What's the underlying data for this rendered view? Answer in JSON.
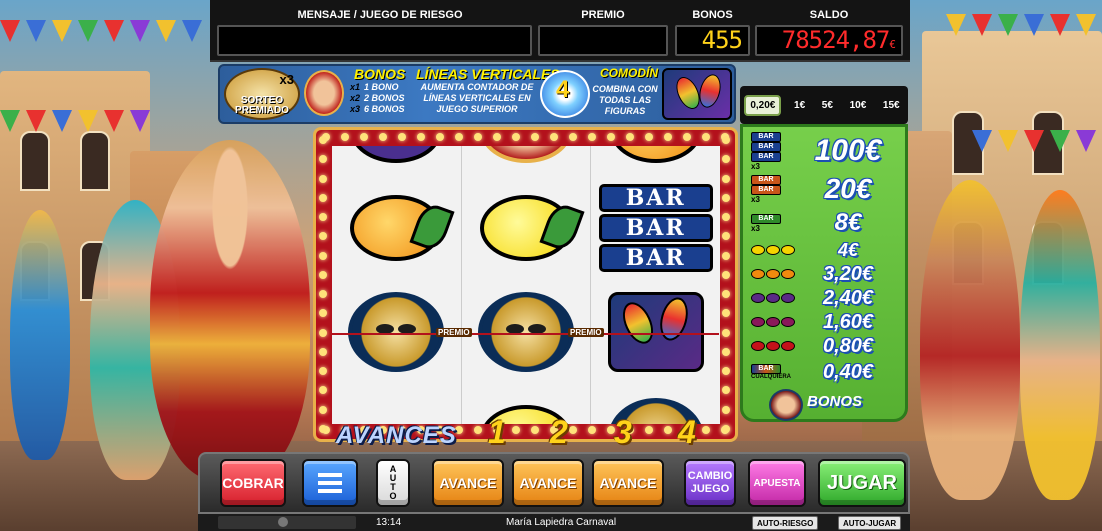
{
  "header": {
    "mensaje_label": "MENSAJE / JUEGO DE RIESGO",
    "mensaje_value": "",
    "premio_label": "PREMIO",
    "premio_value": "",
    "bonos_label": "BONOS",
    "bonos_value": "455",
    "saldo_label": "SALDO",
    "saldo_value": "78524,87",
    "saldo_currency": "€"
  },
  "info": {
    "sorteo_mult": "x3",
    "sorteo_text": "SORTEO PREMIADO",
    "bonos_title": "BONOS",
    "bonos_lines": [
      "1 BONO",
      "2 BONOS",
      "6 BONOS"
    ],
    "bonos_mults": [
      "x1",
      "x2",
      "x3"
    ],
    "lineas_title": "LÍNEAS VERTICALES",
    "lineas_text": "AUMENTA CONTADOR DE LÍNEAS VERTICALES EN JUEGO SUPERIOR",
    "lineas_badge": "4",
    "comodin_title": "COMODÍN",
    "comodin_text": "COMBINA CON TODAS LAS FIGURAS"
  },
  "reels": {
    "premio_label": "PREMIO",
    "columns": [
      [
        "lemon-partial",
        "orange",
        "mask",
        "bar-partial"
      ],
      [
        "face-partial",
        "lemon",
        "mask",
        "lemon-partial"
      ],
      [
        "orange-partial",
        "triple-bar",
        "maracas",
        "mask-partial"
      ]
    ],
    "bar_text": "BAR"
  },
  "avances": {
    "label": "AVANCES",
    "numbers": [
      "1",
      "2",
      "3",
      "4"
    ]
  },
  "paytable": {
    "bet_options": [
      "0,20€",
      "1€",
      "5€",
      "10€",
      "15€"
    ],
    "selected_bet": "0,20€",
    "rows": [
      {
        "icon": "triple-bar-blue",
        "mult": "x3",
        "value": "100€"
      },
      {
        "icon": "double-bar-orange",
        "mult": "x3",
        "value": "20€"
      },
      {
        "icon": "single-bar-green",
        "mult": "x3",
        "value": "8€"
      },
      {
        "icon": "lemon-x3",
        "mult": "",
        "value": "4€"
      },
      {
        "icon": "orange-x3",
        "mult": "",
        "value": "3,20€"
      },
      {
        "icon": "grapes-x3",
        "mult": "",
        "value": "2,40€"
      },
      {
        "icon": "plum-x3",
        "mult": "",
        "value": "1,60€"
      },
      {
        "icon": "cherry-x3",
        "mult": "",
        "value": "0,80€"
      },
      {
        "icon": "any-bar",
        "mult": "",
        "value": "0,40€"
      }
    ],
    "any_bar_label": "CUALQUIERA",
    "bonos_label": "BONOS"
  },
  "buttons": {
    "cobrar": "COBRAR",
    "auto": "AUTO",
    "avance1": "AVANCE",
    "avance2": "AVANCE",
    "avance3": "AVANCE",
    "cambio_juego": "CAMBIO JUEGO",
    "apuesta": "APUESTA",
    "jugar": "JUGAR"
  },
  "status": {
    "time": "13:14",
    "game_name": "María Lapiedra Carnaval",
    "auto_riesgo": "AUTO-RIESGO",
    "auto_jugar": "AUTO-JUGAR"
  },
  "colors": {
    "panel_green": "#56b031",
    "reel_frame": "#b3111c",
    "digit_yellow": "#ffd21a",
    "digit_red": "#ff2b2b"
  }
}
